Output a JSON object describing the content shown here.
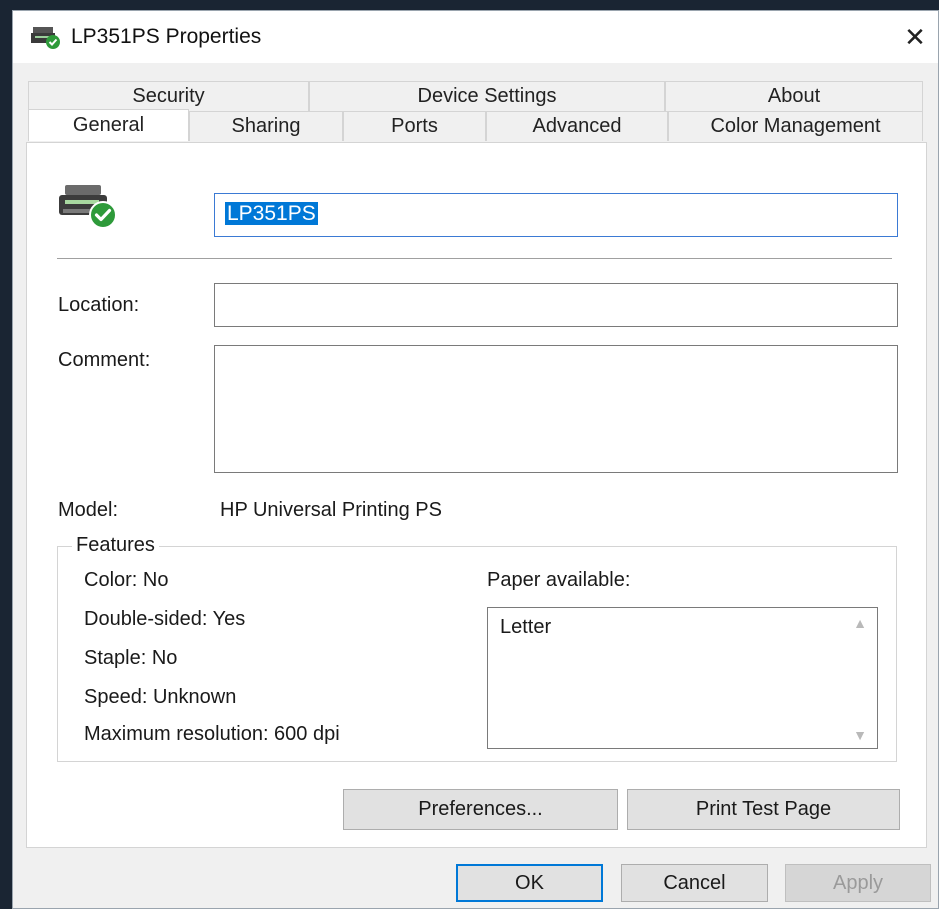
{
  "window": {
    "title": "LP351PS Properties",
    "close_glyph": "✕"
  },
  "tabs": {
    "row_top": [
      {
        "label": "Security"
      },
      {
        "label": "Device Settings"
      },
      {
        "label": "About"
      }
    ],
    "row_bottom": [
      {
        "label": "General",
        "active": true
      },
      {
        "label": "Sharing"
      },
      {
        "label": "Ports"
      },
      {
        "label": "Advanced"
      },
      {
        "label": "Color Management"
      }
    ]
  },
  "general": {
    "printer_name": "LP351PS",
    "location_label": "Location:",
    "location_value": "",
    "comment_label": "Comment:",
    "comment_value": "",
    "model_label": "Model:",
    "model_value": "HP Universal Printing PS",
    "features": {
      "legend": "Features",
      "color": "Color: No",
      "double_sided": "Double-sided: Yes",
      "staple": "Staple: No",
      "speed": "Speed: Unknown",
      "max_resolution": "Maximum resolution: 600 dpi",
      "paper_label": "Paper available:",
      "paper_items": [
        "Letter"
      ]
    },
    "preferences_button": "Preferences...",
    "print_test_button": "Print Test Page"
  },
  "footer": {
    "ok": "OK",
    "cancel": "Cancel",
    "apply": "Apply"
  },
  "icons": {
    "title": "printer-status-icon",
    "printer": "printer-ready-icon",
    "close": "close-icon",
    "scroll_up": "chevron-up-icon",
    "scroll_down": "chevron-down-icon"
  },
  "colors": {
    "accent": "#0078d7",
    "ready_green": "#2e9a3a"
  }
}
